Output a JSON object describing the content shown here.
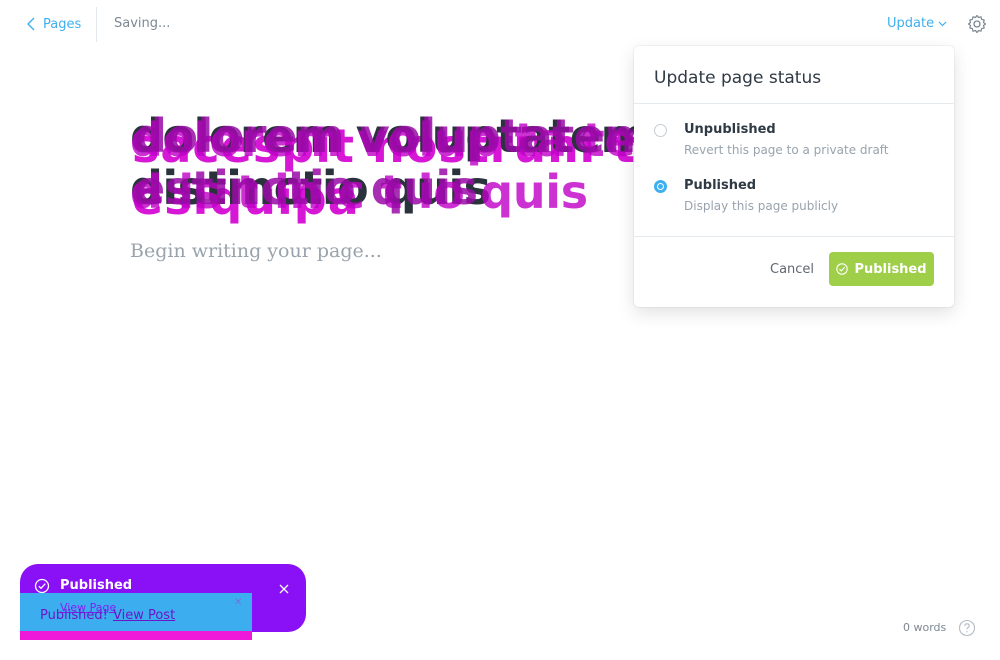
{
  "topbar": {
    "back_label": "Pages",
    "status": "Saving...",
    "update_label": "Update"
  },
  "editor": {
    "title_text": "dolorem voluptatem harum\ndistinctio quis",
    "ghost_text_1": "sacespit nostrum tatem la\nesiquipa",
    "ghost_text_2": "dolorem voluptatem h\nestinctio quis",
    "ghost_text_3": "dolorem volup ta te m a\nd is t in c t io quis",
    "placeholder": "Begin writing your page..."
  },
  "popover": {
    "title": "Update page status",
    "options": [
      {
        "label": "Unpublished",
        "description": "Revert this page to a private draft",
        "selected": false
      },
      {
        "label": "Published",
        "description": "Display this page publicly",
        "selected": true
      }
    ],
    "cancel_label": "Cancel",
    "confirm_label": "Published"
  },
  "notification": {
    "title": "Published",
    "view_page_label": "View Page",
    "message": "Published!",
    "view_post_label": "View Post",
    "colors": {
      "purple": "#8a10f5",
      "magenta": "#ef1ad9",
      "blue": "#3caeef"
    }
  },
  "footer": {
    "word_count": "0 words"
  },
  "colors": {
    "accent": "#3eb0ef",
    "publish_green": "#9fce49"
  }
}
